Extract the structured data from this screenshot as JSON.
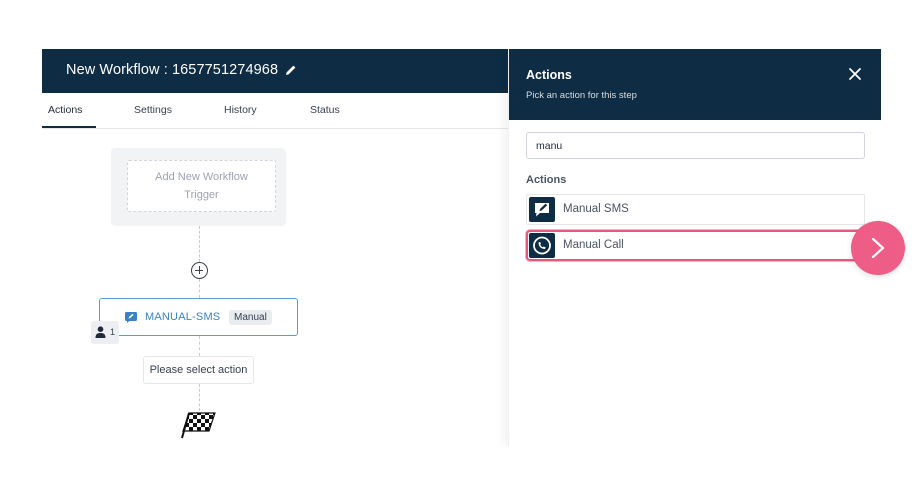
{
  "workflow": {
    "title": "New Workflow : 1657751274968",
    "edit_icon": "pencil-icon"
  },
  "tabs": [
    {
      "label": "Actions",
      "active": true
    },
    {
      "label": "Settings",
      "active": false
    },
    {
      "label": "History",
      "active": false
    },
    {
      "label": "Status",
      "active": false
    }
  ],
  "canvas": {
    "trigger_placeholder": "Add New Workflow Trigger",
    "add_step_icon": "plus-circle-icon",
    "action_node": {
      "label": "MANUAL-SMS",
      "badge": "Manual",
      "icon": "sms-icon"
    },
    "user_chip": {
      "count": "1",
      "icon": "user-icon"
    },
    "select_action_text": "Please select action",
    "end_icon": "checkered-flag-icon"
  },
  "panel": {
    "title": "Actions",
    "subtitle": "Pick an action for this step",
    "close_icon": "close-icon",
    "search": {
      "value": "manu",
      "placeholder": ""
    },
    "section_label": "Actions",
    "items": [
      {
        "label": "Manual SMS",
        "icon": "sms-pencil-icon",
        "highlighted": false
      },
      {
        "label": "Manual Call",
        "icon": "phone-call-icon",
        "highlighted": true
      }
    ]
  },
  "next_button": {
    "icon": "chevron-right-icon"
  },
  "colors": {
    "header_bg": "#0e2c43",
    "highlight": "#e8587e",
    "next_button": "#ee5d85",
    "node_border": "#5b9bd5"
  }
}
